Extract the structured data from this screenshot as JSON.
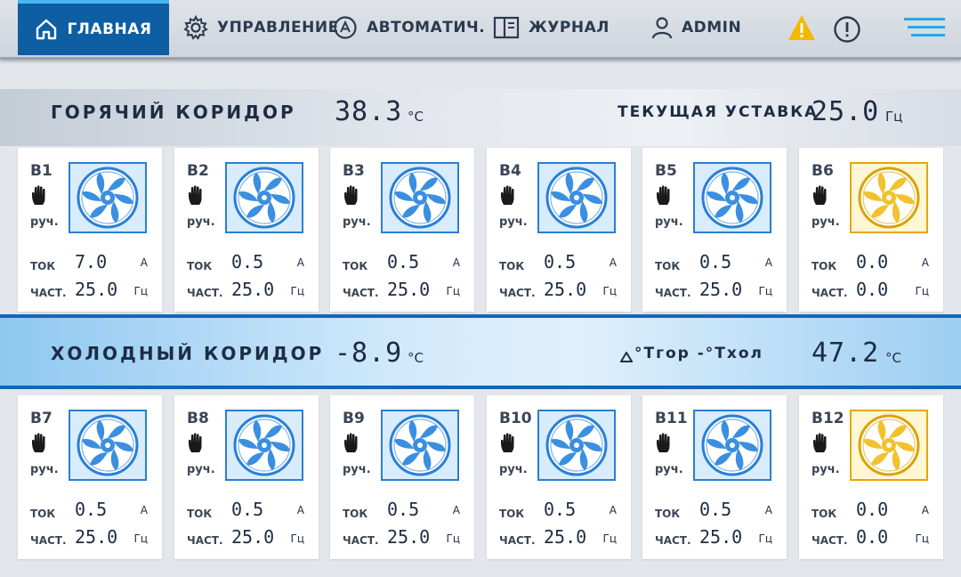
{
  "nav": {
    "items": [
      {
        "label": "ГЛАВНАЯ",
        "icon": "home-icon"
      },
      {
        "label": "УПРАВЛЕНИЕ",
        "icon": "gear-icon"
      },
      {
        "label": "АВТОМАТИЧ.",
        "icon": "auto-icon"
      },
      {
        "label": "ЖУРНАЛ",
        "icon": "book-icon"
      },
      {
        "label": "ADMIN",
        "icon": "user-icon"
      }
    ]
  },
  "hot": {
    "title": "ГОРЯЧИЙ КОРИДОР",
    "temp": "38.3",
    "temp_unit": "°С",
    "setpoint_label": "ТЕКУЩАЯ УСТАВКА",
    "setpoint": "25.0",
    "setpoint_unit": "Гц"
  },
  "cold": {
    "title": "ХОЛОДНЫЙ КОРИДОР",
    "temp": "-8.9",
    "temp_unit": "°С",
    "delta_label": "°Тгор -°Тхол",
    "delta": "47.2",
    "delta_unit": "°С"
  },
  "labels": {
    "current": "ТОК",
    "freq": "ЧАСТ.",
    "current_unit": "А",
    "freq_unit": "Гц"
  },
  "fans": [
    {
      "name": "В1",
      "mode": "руч.",
      "current": "7.0",
      "freq": "25.0",
      "state": "on"
    },
    {
      "name": "В2",
      "mode": "руч.",
      "current": "0.5",
      "freq": "25.0",
      "state": "on"
    },
    {
      "name": "В3",
      "mode": "руч.",
      "current": "0.5",
      "freq": "25.0",
      "state": "on"
    },
    {
      "name": "В4",
      "mode": "руч.",
      "current": "0.5",
      "freq": "25.0",
      "state": "on"
    },
    {
      "name": "В5",
      "mode": "руч.",
      "current": "0.5",
      "freq": "25.0",
      "state": "on"
    },
    {
      "name": "В6",
      "mode": "руч.",
      "current": "0.0",
      "freq": "0.0",
      "state": "off"
    },
    {
      "name": "В7",
      "mode": "руч.",
      "current": "0.5",
      "freq": "25.0",
      "state": "on"
    },
    {
      "name": "В8",
      "mode": "руч.",
      "current": "0.5",
      "freq": "25.0",
      "state": "on"
    },
    {
      "name": "В9",
      "mode": "руч.",
      "current": "0.5",
      "freq": "25.0",
      "state": "on"
    },
    {
      "name": "В10",
      "mode": "руч.",
      "current": "0.5",
      "freq": "25.0",
      "state": "on"
    },
    {
      "name": "В11",
      "mode": "руч.",
      "current": "0.5",
      "freq": "25.0",
      "state": "on"
    },
    {
      "name": "В12",
      "mode": "руч.",
      "current": "0.0",
      "freq": "0.0",
      "state": "off"
    }
  ],
  "colors": {
    "accent": "#0d5ea3",
    "fan_on": "#3a8fe0",
    "fan_off": "#f2c12e",
    "warning": "#f5b800"
  }
}
